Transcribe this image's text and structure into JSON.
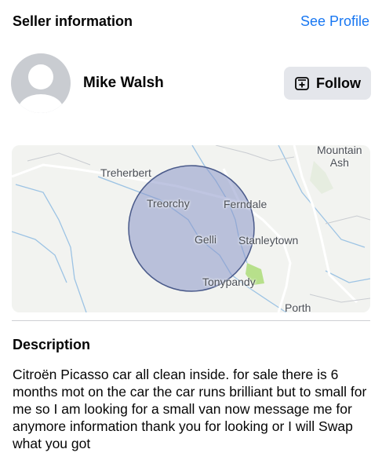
{
  "seller_section": {
    "title": "Seller information",
    "see_profile": "See Profile"
  },
  "seller": {
    "name": "Mike Walsh",
    "follow_label": "Follow"
  },
  "map": {
    "labels": {
      "mountain_ash": "Mountain\nAsh",
      "treherbert": "Treherbert",
      "treorchy": "Treorchy",
      "ferndale": "Ferndale",
      "gelli": "Gelli",
      "stanleytown": "Stanleytown",
      "tonypandy": "Tonypandy",
      "porth": "Porth"
    },
    "colors": {
      "radius_fill": "#8a96c8",
      "radius_stroke": "#4a5a8a",
      "river": "#9cc3e4",
      "road": "#ffffff",
      "land": "#f2f3f0",
      "park": "#b7e08b"
    }
  },
  "description": {
    "title": "Description",
    "text": "Citroën Picasso  car all clean inside. for sale there is 6 months mot on the car the car runs brilliant but to small for me so I am looking for a small van now message me for anymore information thank you for looking  or I will Swap what you got"
  }
}
